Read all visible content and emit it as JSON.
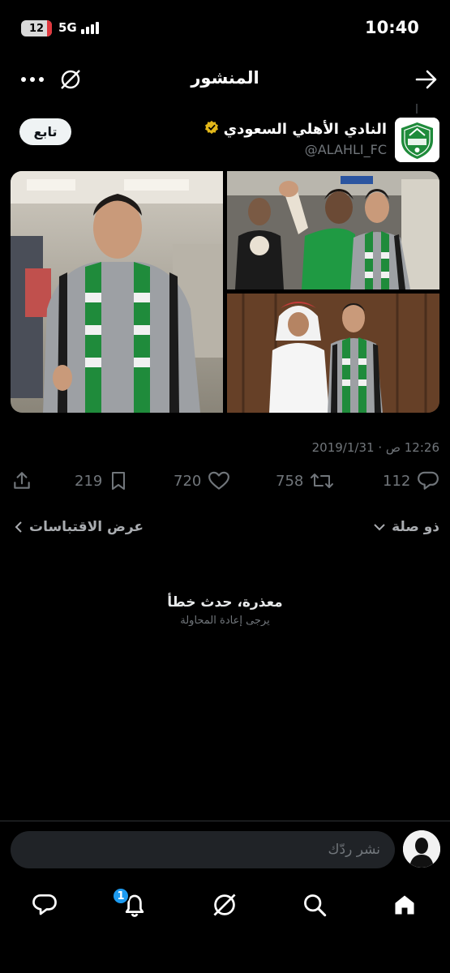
{
  "status_bar": {
    "time": "10:40",
    "battery": "12",
    "network": "5G"
  },
  "header": {
    "title": "المنشور"
  },
  "post": {
    "display_name": "النادي الأهلي السعودي",
    "handle": "@ALAHLI_FC",
    "follow_label": "تابع",
    "timestamp": "12:26 ص · 2019/1/31",
    "stats": {
      "replies": "112",
      "reposts": "758",
      "likes": "720",
      "bookmarks": "219"
    }
  },
  "replies_bar": {
    "sort_label": "ذو صلة",
    "quotes_label": "عرض الاقتباسات"
  },
  "error": {
    "title": "معذرة، حدث خطأ",
    "subtitle": "يرجى إعادة المحاولة"
  },
  "composer": {
    "placeholder": "نشر ردّك"
  },
  "nav": {
    "notifications_badge": "1"
  },
  "colors": {
    "accent": "#1d9bf0",
    "club_green": "#1f8b3b",
    "muted": "#71767b"
  }
}
